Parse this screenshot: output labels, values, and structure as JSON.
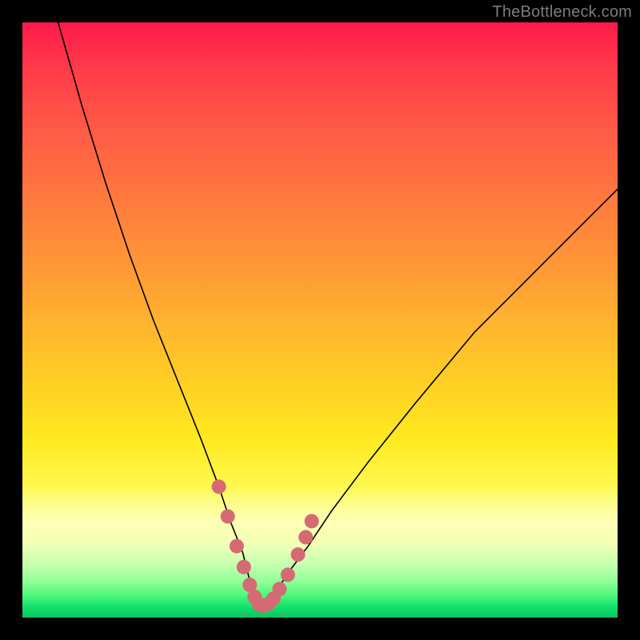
{
  "watermark": "TheBottleneck.com",
  "chart_data": {
    "type": "line",
    "title": "",
    "xlabel": "",
    "ylabel": "",
    "xlim": [
      0,
      100
    ],
    "ylim": [
      0,
      100
    ],
    "grid": false,
    "legend": false,
    "series": [
      {
        "name": "bottleneck-curve",
        "x": [
          6,
          10,
          14,
          18,
          22,
          26,
          30,
          33,
          35,
          37,
          38,
          39,
          40,
          41,
          42,
          43,
          45,
          48,
          52,
          58,
          66,
          76,
          88,
          100
        ],
        "y": [
          100,
          86,
          73,
          61,
          50,
          40,
          30,
          22,
          16,
          11,
          7,
          4,
          2,
          2,
          3,
          5,
          8,
          12,
          18,
          26,
          36,
          48,
          60,
          72
        ],
        "stroke": "#000000",
        "stroke_width": 1.6
      },
      {
        "name": "marker-trough",
        "type": "scatter",
        "x": [
          33,
          34.5,
          36,
          37.2,
          38.2,
          39,
          39.8,
          40.5,
          41.3,
          42.2,
          43.2,
          44.6,
          46.3,
          47.6,
          48.6
        ],
        "y": [
          22,
          17,
          12,
          8.5,
          5.5,
          3.5,
          2.2,
          2,
          2.3,
          3.2,
          4.8,
          7.2,
          10.6,
          13.5,
          16.2
        ],
        "marker_color": "#d66a72",
        "marker_radius": 9
      }
    ],
    "background": {
      "type": "vertical-gradient",
      "stops": [
        {
          "pos": 0.0,
          "color": "#ff1a4b"
        },
        {
          "pos": 0.3,
          "color": "#ff7a3e"
        },
        {
          "pos": 0.62,
          "color": "#ffd324"
        },
        {
          "pos": 0.84,
          "color": "#fcff8e"
        },
        {
          "pos": 0.96,
          "color": "#47f57a"
        },
        {
          "pos": 1.0,
          "color": "#0cc664"
        }
      ]
    }
  }
}
